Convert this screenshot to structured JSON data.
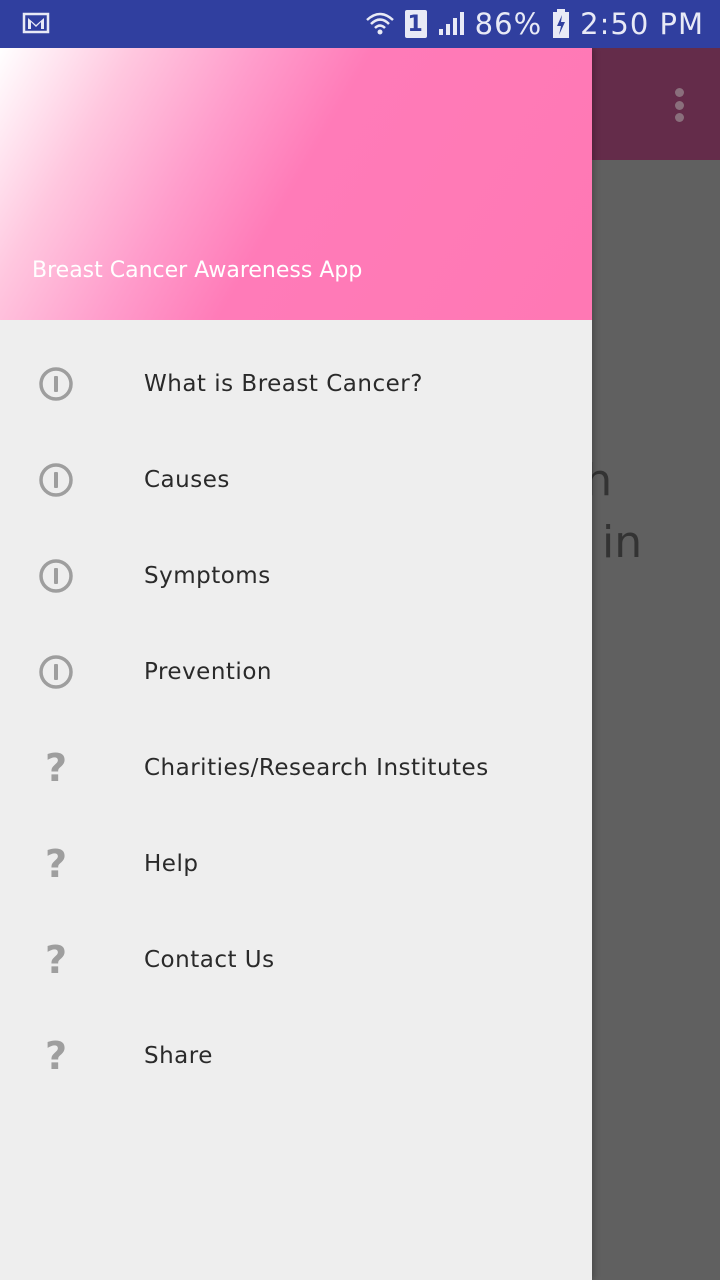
{
  "status_bar": {
    "battery": "86%",
    "time": "2:50 PM",
    "sim": "1",
    "icons": [
      "gmail-icon",
      "wifi-icon",
      "sim-icon",
      "signal-icon",
      "battery-charging-icon"
    ]
  },
  "background": {
    "visible_text_line1": "ch",
    "visible_text_line2": "in",
    "app_bar_color": "#642c4a"
  },
  "drawer": {
    "header_title": "Breast Cancer Awareness App",
    "items": [
      {
        "label": "What is Breast Cancer?",
        "icon": "info-icon"
      },
      {
        "label": "Causes",
        "icon": "info-icon"
      },
      {
        "label": "Symptoms",
        "icon": "info-icon"
      },
      {
        "label": "Prevention",
        "icon": "info-icon"
      },
      {
        "label": "Charities/Research Institutes",
        "icon": "help-icon"
      },
      {
        "label": "Help",
        "icon": "help-icon"
      },
      {
        "label": "Contact Us",
        "icon": "help-icon"
      },
      {
        "label": "Share",
        "icon": "help-icon"
      }
    ]
  },
  "colors": {
    "status_bar": "#303f9f",
    "header_pink": "#ff78b4",
    "drawer_bg": "#eeeeee",
    "icon_gray": "#9e9e9e"
  }
}
